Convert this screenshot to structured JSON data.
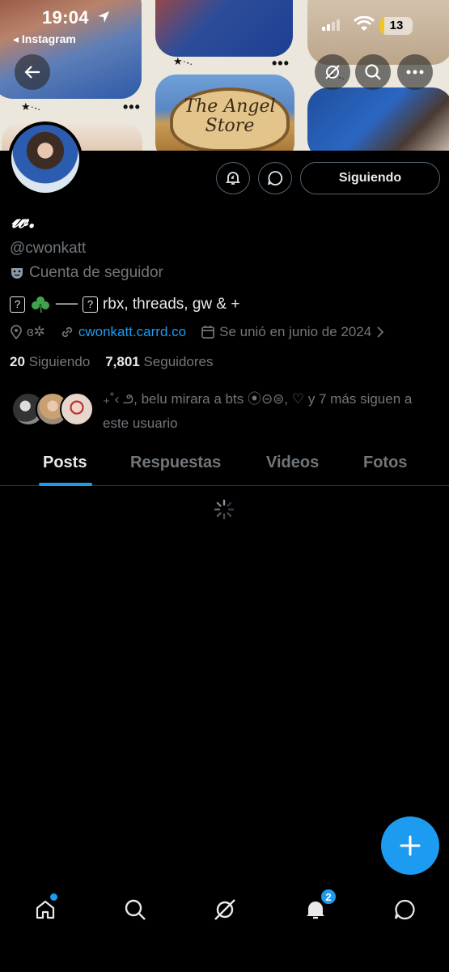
{
  "status_bar": {
    "time": "19:04",
    "back_app": "◂ Instagram",
    "battery": "13",
    "battery_level_percent": 13
  },
  "banner": {
    "sign_text": "The Angel Store",
    "sparkle_text": "★·˖.",
    "more_dots": "•••"
  },
  "profile": {
    "name": "𝓌.",
    "handle": "@cwonkatt",
    "account_type": "Cuenta de seguidor",
    "bio_text": "rbx, threads, gw & +",
    "bio_line": "──",
    "bio_box": "?",
    "location": "ɞ✲",
    "website": "cwonkatt.carrd.co",
    "joined": "Se unió en junio de 2024",
    "following_count": "20",
    "following_label": "Siguiendo",
    "followers_count": "7,801",
    "followers_label": "Seguidores",
    "known_followers_text": "₊˚‹ ౨, belu mirara a bts ⦿⊝⊜, ♡ y 7 más siguen a este usuario",
    "follow_button": "Siguiendo"
  },
  "tabs": [
    {
      "label": "Posts"
    },
    {
      "label": "Respuestas"
    },
    {
      "label": "Videos"
    },
    {
      "label": "Fotos"
    }
  ],
  "bottom_nav": {
    "notifications_badge": "2"
  },
  "colors": {
    "accent": "#1d9bf0",
    "background": "#000000",
    "text_primary": "#e7e9ea",
    "text_secondary": "#71767b",
    "border": "#2f3336",
    "battery_fill": "#f5c518"
  }
}
